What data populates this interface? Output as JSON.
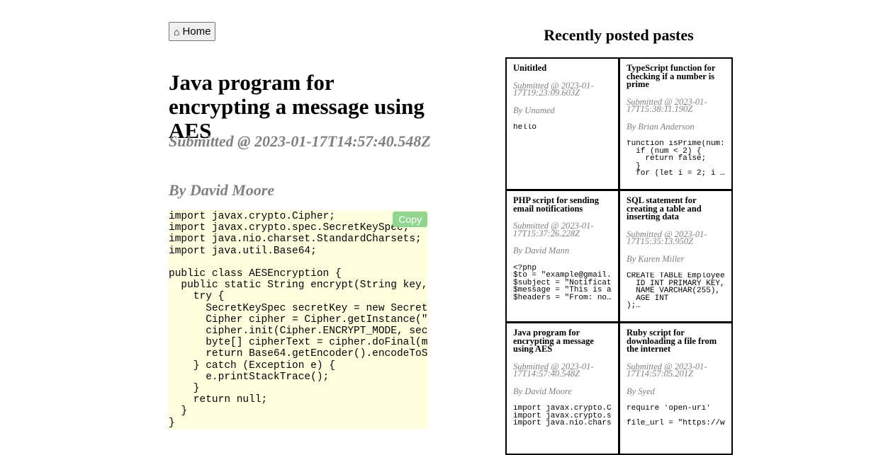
{
  "home_button": {
    "label": "Home",
    "icon": "home-icon"
  },
  "paste": {
    "title": "Java program for encrypting a message using AES",
    "submitted": "Submitted @ 2023-01-17T14:57:40.548Z",
    "author": "By David Moore",
    "copy_label": "Copy",
    "code": "import javax.crypto.Cipher;\nimport javax.crypto.spec.SecretKeySpec;\nimport java.nio.charset.StandardCharsets;\nimport java.util.Base64;\n\npublic class AESEncryption {\n  public static String encrypt(String key, String message) {\n    try {\n      SecretKeySpec secretKey = new SecretKeySpec(\n      Cipher cipher = Cipher.getInstance(\"\n      cipher.init(Cipher.ENCRYPT_MODE, secretKey);\n      byte[] cipherText = cipher.doFinal(m\n      return Base64.getEncoder().encodeToS\n    } catch (Exception e) {\n      e.printStackTrace();\n    }\n    return null;\n  }\n}"
  },
  "recent": {
    "heading": "Recently posted pastes",
    "items": [
      {
        "title": "Unititled",
        "submitted": "Submitted @ 2023-01-17T19:23:09.603Z",
        "author": "By Unamed",
        "code": "hello"
      },
      {
        "title": "TypeScript function for checking if a number is prime",
        "submitted": "Submitted @ 2023-01-17T15:38:11.190Z",
        "author": "By Brian Anderson",
        "code": "function isPrime(num:\n  if (num < 2) {\n    return false;\n  }\n  for (let i = 2; i …"
      },
      {
        "title": "PHP script for sending email notifications",
        "submitted": "Submitted @ 2023-01-17T15:37:26.228Z",
        "author": "By David Mann",
        "code": "<?php\n$to = \"example@gmail.\n$subject = \"Notificat\n$message = \"This is a\n$headers = \"From: no…"
      },
      {
        "title": "SQL statement for creating a table and inserting data",
        "submitted": "Submitted @ 2023-01-17T15:35:13.950Z",
        "author": "By Karen Miller",
        "code": "CREATE TABLE Employee\n  ID INT PRIMARY KEY,\n  NAME VARCHAR(255),\n  AGE INT\n);…"
      },
      {
        "title": "Java program for encrypting a message using AES",
        "submitted": "Submitted @ 2023-01-17T14:57:40.548Z",
        "author": "By David Moore",
        "code": "import javax.crypto.C\nimport javax.crypto.s\nimport java.nio.chars"
      },
      {
        "title": "Ruby script for downloading a file from the internet",
        "submitted": "Submitted @ 2023-01-17T14:57:05.201Z",
        "author": "By Syed",
        "code": "require 'open-uri'\n\nfile_url = \"https://w"
      }
    ]
  }
}
